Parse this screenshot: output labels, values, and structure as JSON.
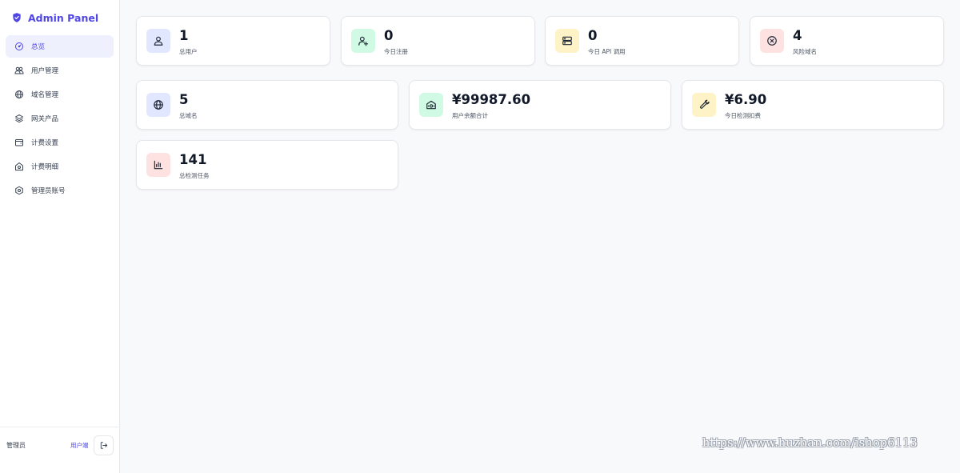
{
  "app": {
    "title": "Admin Panel",
    "accent": "#4f46e5"
  },
  "sidebar": {
    "items": [
      {
        "label": "总览",
        "icon": "dashboard-gauge-icon",
        "active": true
      },
      {
        "label": "用户管理",
        "icon": "users-icon",
        "active": false
      },
      {
        "label": "域名管理",
        "icon": "globe-icon",
        "active": false
      },
      {
        "label": "网关产品",
        "icon": "layers-icon",
        "active": false
      },
      {
        "label": "计费设置",
        "icon": "wallet-icon",
        "active": false
      },
      {
        "label": "计费明细",
        "icon": "receipt-icon",
        "active": false
      },
      {
        "label": "管理员账号",
        "icon": "settings-gear-icon",
        "active": false
      }
    ],
    "footer": {
      "user": "管理员",
      "user_link": "用户端",
      "logout_icon": "logout-icon"
    }
  },
  "stats": [
    {
      "value": "1",
      "label": "总用户",
      "icon": "user-icon",
      "color": "#e0e7ff"
    },
    {
      "value": "0",
      "label": "今日注册",
      "icon": "user-plus-icon",
      "color": "#d1fae5"
    },
    {
      "value": "0",
      "label": "今日 API 调用",
      "icon": "server-icon",
      "color": "#fef3c7"
    },
    {
      "value": "4",
      "label": "风险域名",
      "icon": "circle-x-icon",
      "color": "#fee2e2"
    },
    {
      "value": "5",
      "label": "总域名",
      "icon": "globe-icon",
      "color": "#e0e7ff"
    },
    {
      "value": "¥99987.60",
      "label": "用户余额合计",
      "icon": "money-icon",
      "color": "#d1fae5"
    },
    {
      "value": "¥6.90",
      "label": "今日检测扣费",
      "icon": "wrench-icon",
      "color": "#fef3c7"
    },
    {
      "value": "141",
      "label": "总检测任务",
      "icon": "bar-chart-icon",
      "color": "#fee2e2"
    }
  ],
  "watermark": "https://www.huzhan.com/ishop6113"
}
